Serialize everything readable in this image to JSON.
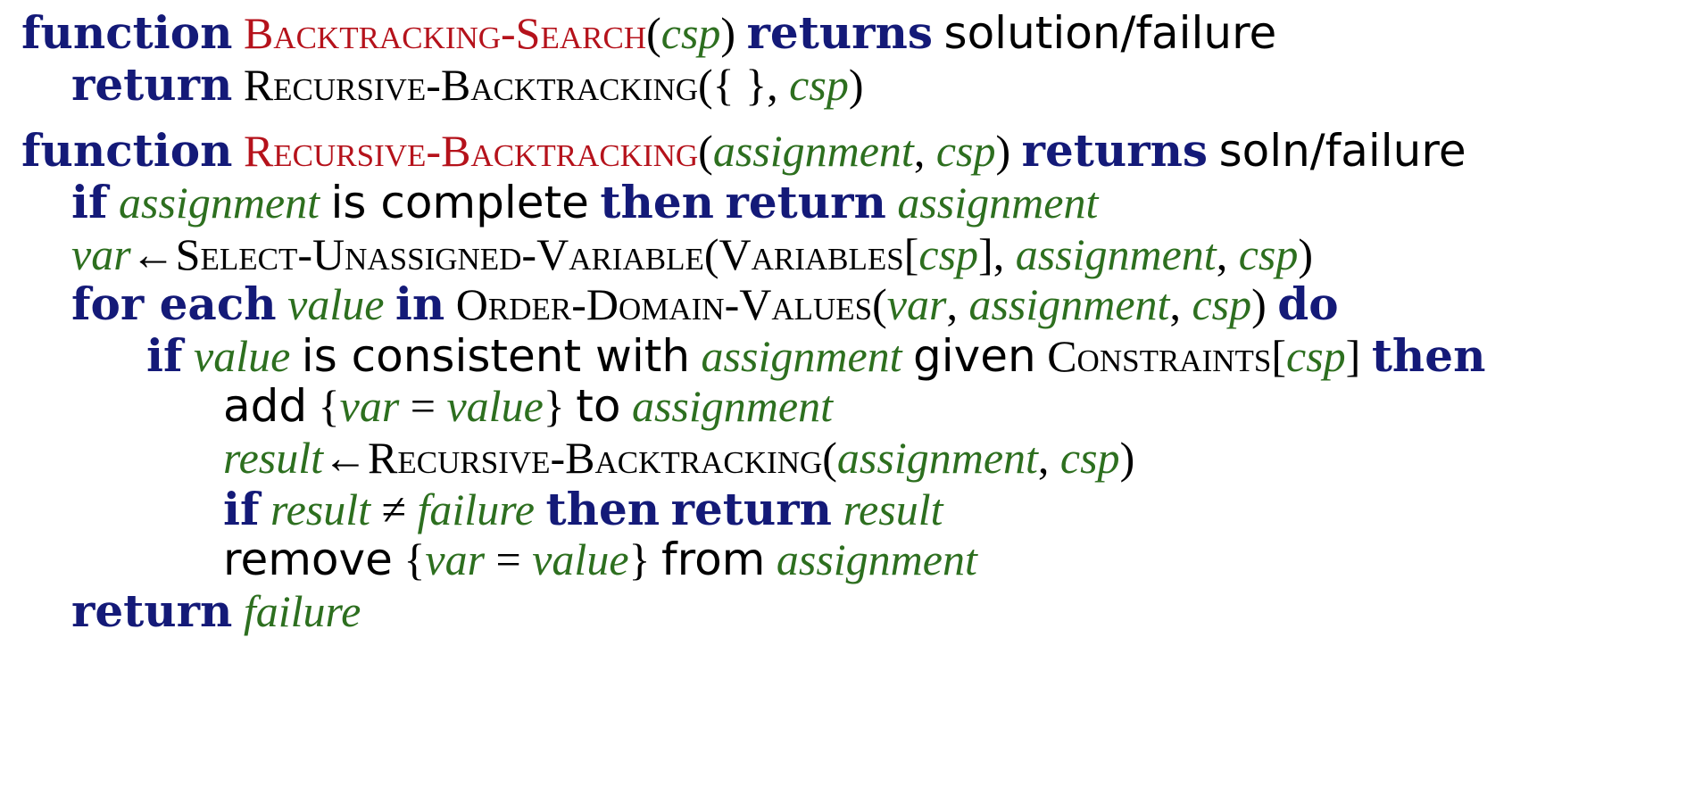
{
  "colors": {
    "keyword": "#141a78",
    "function_definition": "#b5121b",
    "variable": "#2d6f1f",
    "text": "#000000"
  },
  "keywords": {
    "function": "function",
    "returns": "returns",
    "return": "return",
    "if": "if",
    "then": "then",
    "for_each": "for each",
    "in": "in",
    "do": "do"
  },
  "functions": {
    "backtracking_search": "Backtracking-Search",
    "recursive_backtracking": "Recursive-Backtracking",
    "select_unassigned_variable": "Select-Unassigned-Variable",
    "variables": "Variables",
    "order_domain_values": "Order-Domain-Values",
    "constraints": "Constraints"
  },
  "vars": {
    "csp": "csp",
    "assignment": "assignment",
    "var": "var",
    "value": "value",
    "result": "result",
    "failure": "failure"
  },
  "text": {
    "solution_failure": "solution/failure",
    "soln_failure": "soln/failure",
    "is_complete": "is complete",
    "is_consistent_with": "is consistent with",
    "given": "given",
    "add": "add",
    "to": "to",
    "remove": "remove",
    "from": "from"
  },
  "symbols": {
    "open_paren": "(",
    "close_paren": ")",
    "comma": ",",
    "empty_set": "{ }",
    "arrow": "←",
    "open_bracket": "[",
    "close_bracket": "]",
    "open_brace": "{",
    "close_brace": "}",
    "equals": "=",
    "not_equal": "≠"
  }
}
